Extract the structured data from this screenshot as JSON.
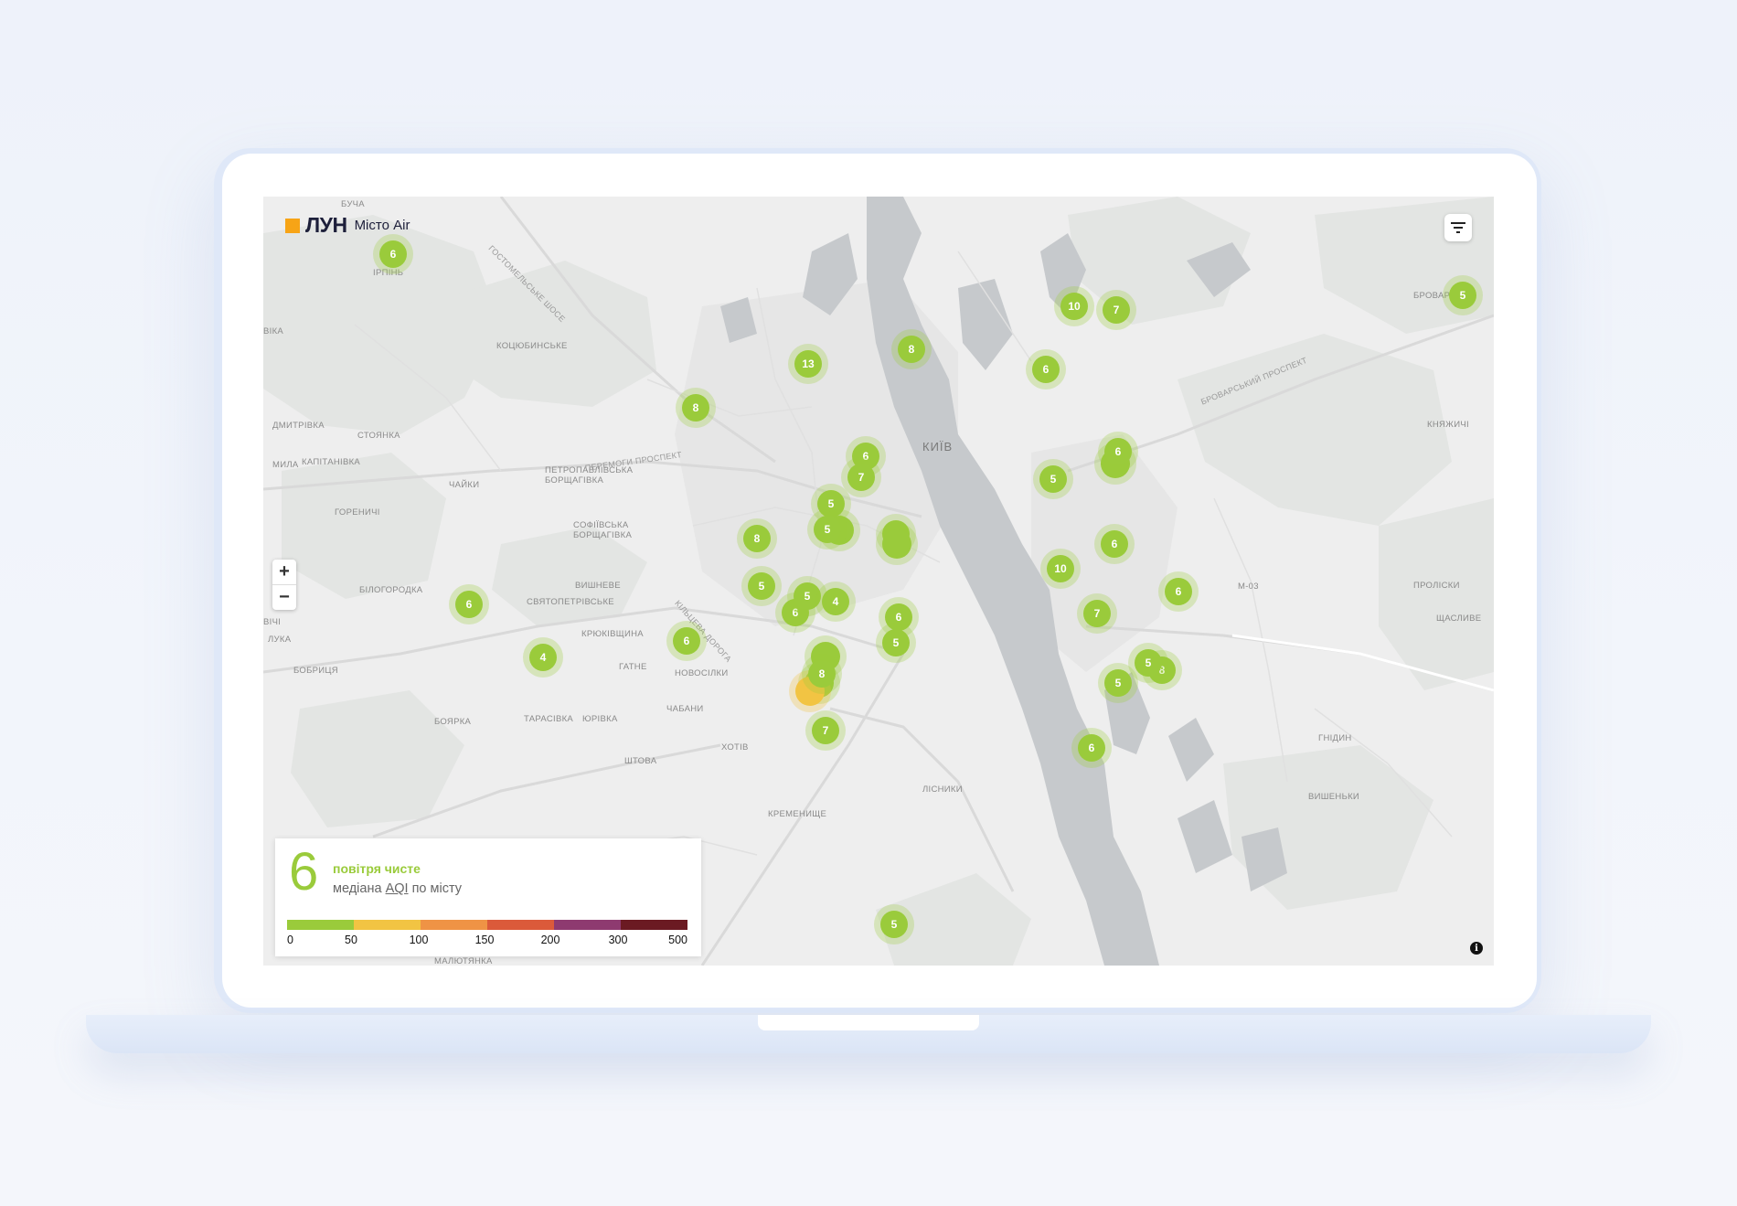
{
  "header": {
    "logo_brand": "ЛУН",
    "logo_product": "Місто Air"
  },
  "controls": {
    "zoom_in": "+",
    "zoom_out": "−",
    "filter_icon": "filter-icon",
    "info_icon": "i"
  },
  "places": [
    {
      "name": "БУЧА"
    },
    {
      "name": "ІРПІНЬ"
    },
    {
      "name": "КОЦЮБИНСЬКЕ"
    },
    {
      "name": "ДМИТРІВКА"
    },
    {
      "name": "СТОЯНКА"
    },
    {
      "name": "КАПІТАНІВКА"
    },
    {
      "name": "МИЛА"
    },
    {
      "name": "ЧАЙКИ"
    },
    {
      "name": "ГОРЕНИЧІ"
    },
    {
      "name": "ПЕТРОПАВЛІВСЬКА"
    },
    {
      "name": "БОРЩАГІВКА"
    },
    {
      "name": "СОФІЇВСЬКА"
    },
    {
      "name": "БОРЩАГІВКА"
    },
    {
      "name": "КИЇВ"
    },
    {
      "name": "БІЛОГОРОДКА"
    },
    {
      "name": "ВИШНЕВЕ"
    },
    {
      "name": "СВЯТОПЕТРІВСЬКЕ"
    },
    {
      "name": "КРЮКІВЩИНА"
    },
    {
      "name": "ГАТНЕ"
    },
    {
      "name": "НОВОСІЛКИ"
    },
    {
      "name": "ЛУКА"
    },
    {
      "name": "БОБРИЦЯ"
    },
    {
      "name": "ЧАБАНИ"
    },
    {
      "name": "БОЯРКА"
    },
    {
      "name": "ТАРАСІВКА"
    },
    {
      "name": "ЮРІВКА"
    },
    {
      "name": "ХОТІВ"
    },
    {
      "name": "ШТОВА"
    },
    {
      "name": "ЛІСНИКИ"
    },
    {
      "name": "КРЕМЕНИЩЕ"
    },
    {
      "name": "МАЛЮТЯНКА"
    },
    {
      "name": "БРОВАРИ"
    },
    {
      "name": "КНЯЖИЧІ"
    },
    {
      "name": "ПРОЛІСКИ"
    },
    {
      "name": "ЩАСЛИВЕ"
    },
    {
      "name": "ГНІДИН"
    },
    {
      "name": "ВИШЕНЬКИ"
    },
    {
      "name": "М-03"
    },
    {
      "name": "ВІКА"
    },
    {
      "name": "ВІЧІ"
    }
  ],
  "road_labels": [
    {
      "name": "ГОСТОМЕЛЬСЬКЕ ШОСЕ"
    },
    {
      "name": "ПЕРЕМОГИ ПРОСПЕКТ"
    },
    {
      "name": "БРОВАРСЬКИЙ ПРОСПЕКТ"
    },
    {
      "name": "КІЛЬЦЕВА ДОРОГА"
    }
  ],
  "markers": [
    {
      "label": "6"
    },
    {
      "label": "13"
    },
    {
      "label": "8"
    },
    {
      "label": "8"
    },
    {
      "label": "6"
    },
    {
      "label": "6"
    },
    {
      "label": "7"
    },
    {
      "label": "5"
    },
    {
      "label": ""
    },
    {
      "label": "5"
    },
    {
      "label": "8"
    },
    {
      "label": "6"
    },
    {
      "label": ""
    },
    {
      "label": "5"
    },
    {
      "label": "5"
    },
    {
      "label": "4"
    },
    {
      "label": "6"
    },
    {
      "label": "5"
    },
    {
      "label": "6"
    },
    {
      "label": "6"
    },
    {
      "label": "4"
    },
    {
      "label": ""
    },
    {
      "label": ""
    },
    {
      "label": ""
    },
    {
      "label": "8"
    },
    {
      "label": "7"
    },
    {
      "label": "10"
    },
    {
      "label": "7"
    },
    {
      "label": "6"
    },
    {
      "label": "5"
    },
    {
      "label": "5"
    },
    {
      "label": ""
    },
    {
      "label": "6"
    },
    {
      "label": "6"
    },
    {
      "label": "10"
    },
    {
      "label": "6"
    },
    {
      "label": "7"
    },
    {
      "label": "5"
    },
    {
      "label": "8"
    },
    {
      "label": "5"
    },
    {
      "label": "6"
    },
    {
      "label": "5"
    }
  ],
  "aqi_panel": {
    "value": "6",
    "status": "повітря чисте",
    "caption_prefix": "медіана ",
    "caption_link": "AQI",
    "caption_suffix": " по місту",
    "scale_colors": [
      "#9acb3b",
      "#f2c443",
      "#ef9345",
      "#db5a3a",
      "#8e3a70",
      "#6b1a22"
    ],
    "scale_labels": [
      "0",
      "50",
      "100",
      "150",
      "200",
      "300",
      "500"
    ]
  }
}
